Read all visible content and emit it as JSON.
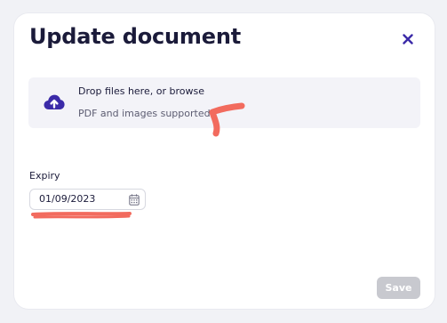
{
  "dialog": {
    "title": "Update document",
    "close_icon": "close-icon"
  },
  "upload": {
    "icon": "cloud-upload-icon",
    "label": "Drop files here, or browse",
    "hint": "PDF and images supported"
  },
  "expiry": {
    "label": "Expiry",
    "value": "01/09/2023",
    "icon": "calendar-icon"
  },
  "footer": {
    "save_label": "Save",
    "save_enabled": false
  },
  "colors": {
    "accent": "#3b2aa8",
    "annotation": "#f26b5e",
    "disabled_button": "#c8c9cf"
  }
}
